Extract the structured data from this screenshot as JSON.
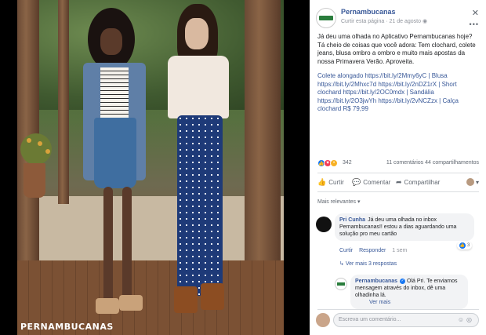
{
  "photo": {
    "brand_watermark": "PERNAMBUCANAS"
  },
  "post": {
    "page_name": "Pernambucanas",
    "like_page_link": "Curtir esta página",
    "date": "21 de agosto",
    "paragraphs": [
      "Já deu uma olhada no Aplicativo Pernambucanas hoje? Tá cheio de coisas que você adora: Tem clochard, colete jeans, blusa ombro a ombro e muito mais apostas da nossa Primavera Verão. Aproveita.",
      "Colete alongado https://bit.ly/2Mmy6yC | Blusa https://bit.ly/2Mhxc7d https://bit.ly/2nDZ1rX | Short clochard https://bit.ly/2OC0mdx | Sandália https://bit.ly/2O3jwYh https://bit.ly/2vNCZzx | Calça clochard R$ 79,99"
    ],
    "reaction_count": "342",
    "comment_count": "11 comentários",
    "share_count": "44 compartilhamentos",
    "actions": {
      "like": "Curtir",
      "comment": "Comentar",
      "share": "Compartilhar"
    },
    "sort_label": "Mais relevantes"
  },
  "comments": [
    {
      "author": "Pri Cunha",
      "text": "Já deu uma olhada no inbox Pernambucanas!! estou a dias aguardando uma solução pro meu cartão",
      "actions": [
        "Curtir",
        "Responder"
      ],
      "time": "1 sem",
      "likes": "3",
      "replies_link": "Ver mais 3 respostas"
    },
    {
      "author": "Pernambucanas",
      "text": "Olá Pri. Te enviamos mensagem através do inbox, dê uma olhadinha lá.",
      "see_more": "Ver mais"
    }
  ],
  "composer": {
    "placeholder": "Escreva um comentário..."
  }
}
